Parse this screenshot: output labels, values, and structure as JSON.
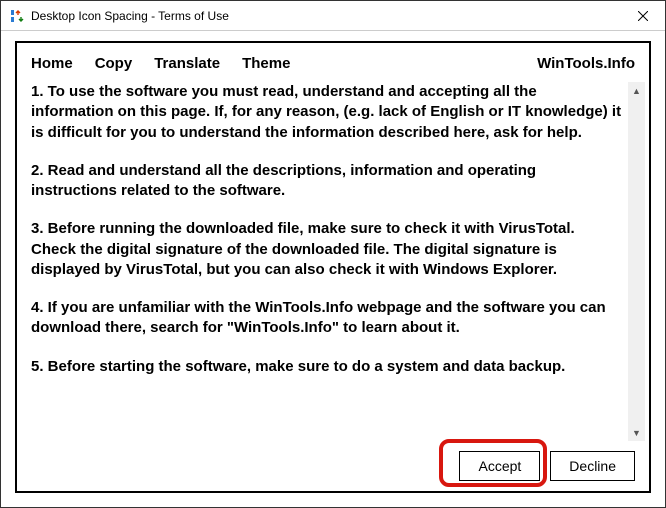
{
  "window": {
    "title": "Desktop Icon Spacing - Terms of Use"
  },
  "menu": {
    "home": "Home",
    "copy": "Copy",
    "translate": "Translate",
    "theme": "Theme",
    "brand": "WinTools.Info"
  },
  "terms": {
    "p1": "1. To use the software you must read, understand and accepting all the information on this page. If, for any reason, (e.g. lack of English or IT knowledge) it is difficult for you to understand the information described here, ask for help.",
    "p2": "2. Read and understand all the descriptions, information and operating instructions related to the software.",
    "p3": "3. Before running the downloaded file, make sure to check it with VirusTotal. Check the digital signature of the downloaded file. The digital signature is displayed by VirusTotal, but you can also check it with Windows Explorer.",
    "p4": "4. If you are unfamiliar with the WinTools.Info webpage and the software you can download there, search for \"WinTools.Info\" to learn about it.",
    "p5": "5. Before starting the software, make sure to do a system and data backup."
  },
  "buttons": {
    "accept": "Accept",
    "decline": "Decline"
  }
}
